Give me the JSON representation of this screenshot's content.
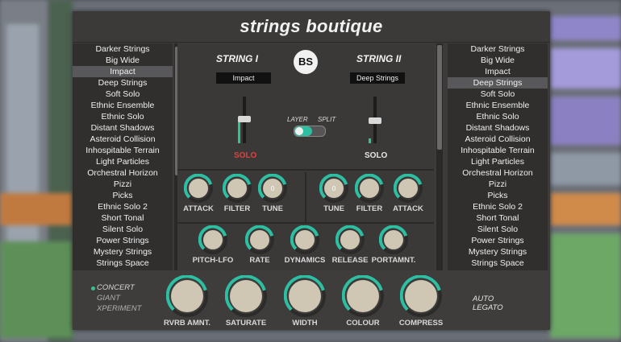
{
  "plugin_title": "strings boutique",
  "string1": {
    "header": "STRING I",
    "selected": "Impact",
    "solo": "SOLO",
    "solo_color": "#e2413b",
    "level": 0.55
  },
  "string2": {
    "header": "STRING II",
    "selected": "Deep Strings",
    "solo": "SOLO",
    "solo_color": "#e6e6e6",
    "level": 0.1
  },
  "logo_text": "BS",
  "layer_split": {
    "layer": "LAYER",
    "split": "SPLIT"
  },
  "left_list": [
    "Darker Strings",
    "Big Wide",
    "Impact",
    "Deep Strings",
    "Soft Solo",
    "Ethnic Ensemble",
    "Ethnic Solo",
    "Distant Shadows",
    "Asteroid Collision",
    "Inhospitable Terrain",
    "Light Particles",
    "Orchestral Horizon",
    "Pizzi",
    "Picks",
    "Ethnic Solo 2",
    "Short Tonal",
    "Silent Solo",
    "Power Strings",
    "Mystery Strings",
    "Strings Space"
  ],
  "left_selected_index": 2,
  "right_list": [
    "Darker Strings",
    "Big Wide",
    "Impact",
    "Deep Strings",
    "Soft Solo",
    "Ethnic Ensemble",
    "Ethnic Solo",
    "Distant Shadows",
    "Asteroid Collision",
    "Inhospitable Terrain",
    "Light Particles",
    "Orchestral Horizon",
    "Pizzi",
    "Picks",
    "Ethnic Solo 2",
    "Short Tonal",
    "Silent Solo",
    "Power Strings",
    "Mystery Strings",
    "Strings Space"
  ],
  "right_selected_index": 3,
  "knobs_row1_left": [
    {
      "label": "ATTACK"
    },
    {
      "label": "FILTER"
    },
    {
      "label": "TUNE",
      "value": "0"
    }
  ],
  "knobs_row1_right": [
    {
      "label": "TUNE",
      "value": "0"
    },
    {
      "label": "FILTER"
    },
    {
      "label": "ATTACK"
    }
  ],
  "knobs_row2": [
    {
      "label": "PITCH-LFO"
    },
    {
      "label": "RATE"
    },
    {
      "label": "DYNAMICS"
    },
    {
      "label": "RELEASE"
    },
    {
      "label": "PORTAMNT."
    }
  ],
  "bottom_knobs": [
    {
      "label": "RVRB AMNT."
    },
    {
      "label": "SATURATE"
    },
    {
      "label": "WIDTH"
    },
    {
      "label": "COLOUR"
    },
    {
      "label": "COMPRESS"
    }
  ],
  "modes": {
    "items": [
      "CONCERT",
      "GIANT",
      "XPERIMENT"
    ],
    "active_index": 0
  },
  "auto_legato": {
    "line1": "AUTO",
    "line2": "LEGATO"
  },
  "colors": {
    "accent": "#2ebfa3",
    "knob_face": "#cfc6b4",
    "panel": "#3c3b3a"
  }
}
